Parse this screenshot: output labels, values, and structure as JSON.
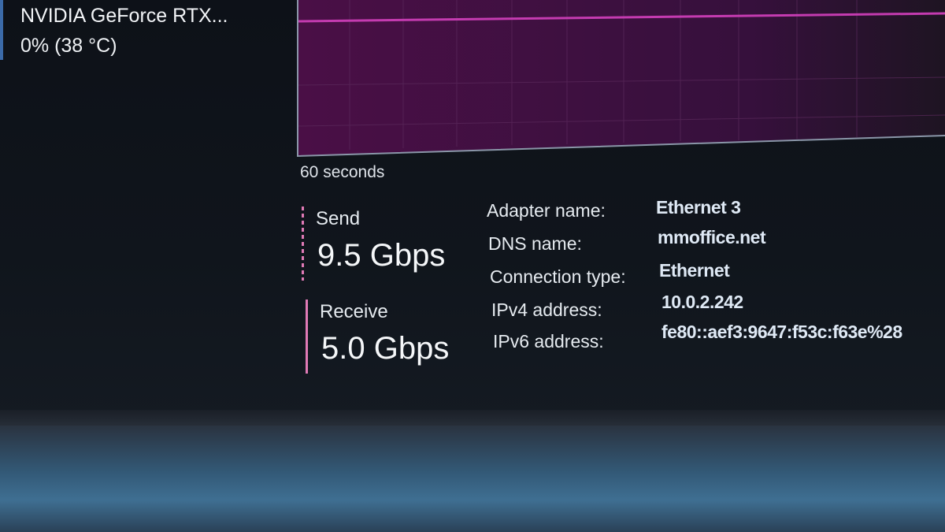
{
  "gpu": {
    "name": "NVIDIA GeForce RTX...",
    "usage": "0%  (38 °C)"
  },
  "chart": {
    "time_label": "60 seconds",
    "line_color": "#c43bb0",
    "fill_color": "#3a0f3a"
  },
  "throughput": {
    "send_label": "Send",
    "send_value": "9.5 Gbps",
    "receive_label": "Receive",
    "receive_value": "5.0 Gbps",
    "accent_color": "#e07ab6"
  },
  "properties": [
    {
      "key": "Adapter name:",
      "value": "Ethernet 3"
    },
    {
      "key": "DNS name:",
      "value": "mmoffice.net"
    },
    {
      "key": "Connection type:",
      "value": "Ethernet"
    },
    {
      "key": "IPv4 address:",
      "value": "10.0.2.242"
    },
    {
      "key": "IPv6 address:",
      "value": "fe80::aef3:9647:f53c:f63e%28"
    }
  ]
}
